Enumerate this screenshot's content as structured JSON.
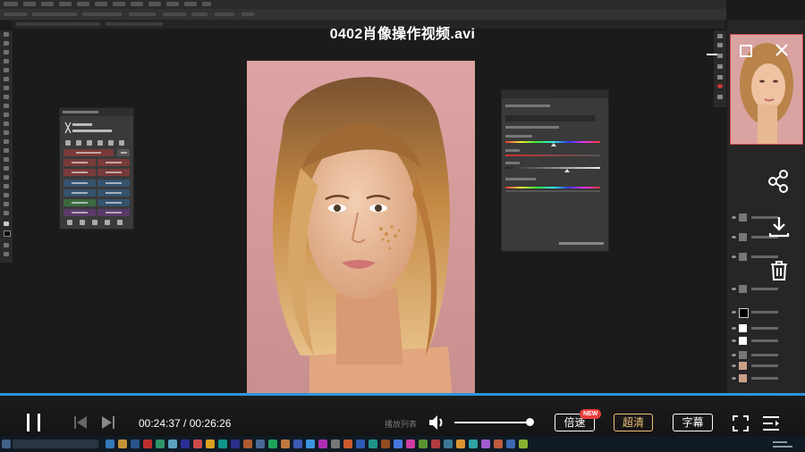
{
  "player": {
    "title": "0402肖像操作视频.avi",
    "current_time": "00:24:37",
    "duration": "00:26:26",
    "time_separator": " / ",
    "speed_label": "倍速",
    "speed_badge": "NEW",
    "quality_label": "超清",
    "subtitle_label": "字幕",
    "ghost_label": "播放列表",
    "progress": 1.0,
    "volume": 0.95,
    "accent_color": "#2f95df",
    "quality_color": "#f2c27a"
  },
  "icons": {
    "pause": "pause-icon",
    "previous": "previous-icon",
    "next": "next-icon",
    "volume": "volume-icon",
    "fullscreen": "fullscreen-icon",
    "playlist": "playlist-icon",
    "share": "share-icon",
    "download": "download-icon",
    "delete": "delete-icon",
    "minimize": "minimize-icon",
    "maximize": "maximize-icon",
    "close": "close-icon"
  }
}
